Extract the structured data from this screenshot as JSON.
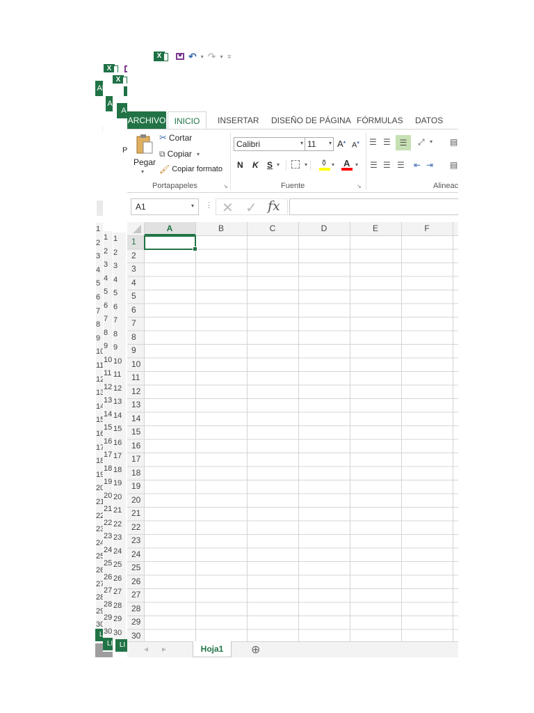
{
  "app": {
    "qat_glyphs": {
      "undo": "↶",
      "redo": "↷",
      "dropdown": "▾",
      "customize": "∓"
    },
    "excel_icon_letter": "X"
  },
  "background_windows": {
    "partial_labels": {
      "ar1": "AR",
      "ar2": "AR",
      "p": "P",
      "archivo_stub": "A"
    },
    "row_numbers": [
      "1",
      "2",
      "3",
      "4",
      "5",
      "6",
      "7",
      "8",
      "9",
      "10",
      "11",
      "12",
      "13",
      "14",
      "15",
      "16",
      "17",
      "18",
      "19",
      "20",
      "21",
      "22",
      "23",
      "24",
      "25",
      "26",
      "27",
      "28",
      "29",
      "30"
    ],
    "sheet_tab_stub": "H",
    "status_stub": "LI"
  },
  "ribbon": {
    "tabs": [
      {
        "label": "ARCHIVO",
        "active": false,
        "file": true
      },
      {
        "label": "INICIO",
        "active": true
      },
      {
        "label": "INSERTAR"
      },
      {
        "label": "DISEÑO DE PÁGINA"
      },
      {
        "label": "FÓRMULAS"
      },
      {
        "label": "DATOS"
      }
    ],
    "clipboard": {
      "paste_label": "Pegar",
      "cut_label": "Cortar",
      "copy_label": "Copiar",
      "format_painter_label": "Copiar formato",
      "group_label": "Portapapeles"
    },
    "font": {
      "font_name": "Calibri",
      "font_size": "11",
      "grow_label": "A",
      "shrink_label": "A",
      "bold": "N",
      "italic": "K",
      "underline": "S",
      "group_label": "Fuente"
    },
    "alignment": {
      "group_label": "Alineac"
    }
  },
  "formula_bar": {
    "name_box": "A1",
    "fx": "fx",
    "formula": ""
  },
  "grid": {
    "columns": [
      "A",
      "B",
      "C",
      "D",
      "E",
      "F"
    ],
    "rows": [
      "1",
      "2",
      "3",
      "4",
      "5",
      "6",
      "7",
      "8",
      "9",
      "10",
      "11",
      "12",
      "13",
      "14",
      "15",
      "16",
      "17",
      "18",
      "19",
      "20",
      "21",
      "22",
      "23",
      "24",
      "25",
      "26",
      "27",
      "28",
      "29",
      "30"
    ],
    "selected_cell": "A1"
  },
  "sheet_tabs": {
    "active": "Hoja1",
    "add_symbol": "⊕",
    "nav_prev": "◂",
    "nav_next": "▸"
  },
  "colors": {
    "accent": "#217346",
    "selection_border": "#217346",
    "gridline": "#d4d4d4",
    "header_bg": "#f3f3f3",
    "selected_header_bg": "#e1e1e1"
  }
}
